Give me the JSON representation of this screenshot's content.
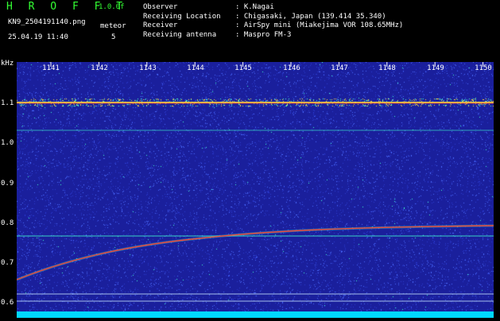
{
  "header": {
    "app_title": "H R O F F T",
    "version": "1.0.0f",
    "filename": "KN9_2504191140.png",
    "meteor_label": "meteor",
    "meteor_count": "5",
    "datetime": "25.04.19 11:40"
  },
  "info": {
    "rows": [
      {
        "label": "Observer",
        "value": ": K.Nagai"
      },
      {
        "label": "Receiving Location",
        "value": ": Chigasaki, Japan (139.414 35.340)"
      },
      {
        "label": "Receiver",
        "value": ": AirSpy mini (Miakejima VOR 108.65MHz)"
      },
      {
        "label": "Receiving antenna",
        "value": ": Maspro FM-3"
      }
    ]
  },
  "axes": {
    "y_unit": "kHz",
    "y_ticks": [
      "1.1",
      "1.0",
      "0.9",
      "0.8",
      "0.7",
      "0.6"
    ],
    "x_ticks": [
      "1141",
      "1142",
      "1143",
      "1144",
      "1145",
      "1146",
      "1147",
      "1148",
      "1149",
      "1150"
    ]
  },
  "colors": {
    "background": "#1a1f9c",
    "noise": "#4a6cff",
    "trace_hot": "#ff4030",
    "trace_warm": "#ffe040",
    "trace_cool": "#40ffd0",
    "bottom_band": "#00d8ff"
  }
}
